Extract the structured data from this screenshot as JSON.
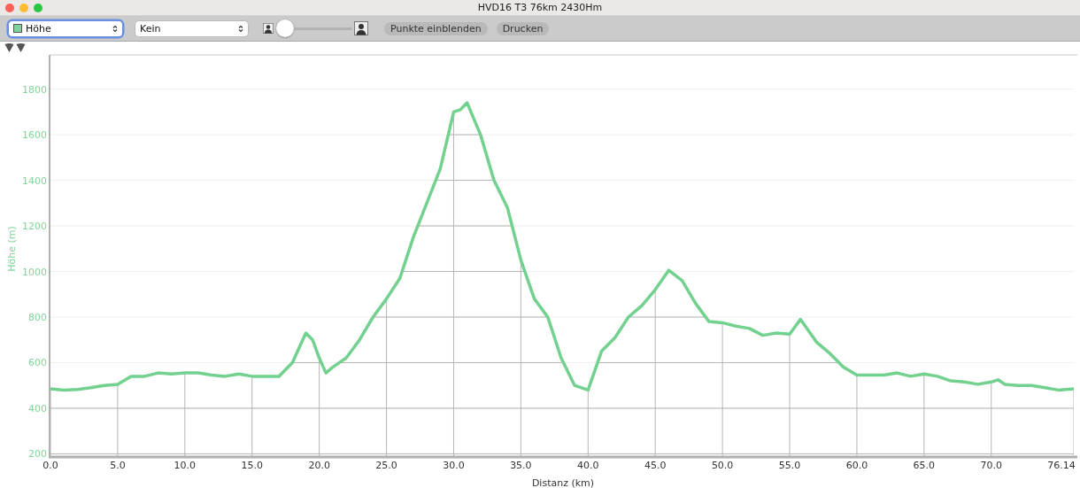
{
  "window": {
    "title": "HVD16 T3 76km 2430Hm"
  },
  "toolbar": {
    "data_select": {
      "value": "Höhe",
      "focused": true
    },
    "overlay_select": {
      "value": "Kein",
      "focused": false
    },
    "zoom_slider": {
      "level": 0
    },
    "buttons": [
      "Punkte einblenden",
      "Drucken"
    ]
  },
  "chart": {
    "chart_data": {
      "type": "line",
      "xlabel": "Distanz (km)",
      "ylabel": "Höhe (m)",
      "x": [
        0,
        1,
        2,
        3,
        4,
        5,
        6,
        7,
        8,
        9,
        10,
        11,
        12,
        13,
        14,
        15,
        16,
        17,
        18,
        19,
        19.5,
        20,
        20.5,
        21,
        22,
        23,
        24,
        25,
        26,
        27,
        28,
        29,
        30,
        30.5,
        31,
        32,
        33,
        34,
        35,
        36,
        37,
        38,
        39,
        40,
        41,
        42,
        43,
        44,
        45,
        46,
        47,
        48,
        49,
        50,
        51,
        52,
        53,
        54,
        55,
        55.8,
        57,
        58,
        59,
        60,
        61,
        62,
        63,
        64,
        65,
        66,
        67,
        68,
        69,
        70,
        70.5,
        71,
        72,
        73,
        74,
        75,
        76.14
      ],
      "grid": true,
      "series": [
        {
          "color": "#72d18e",
          "values": [
            485,
            480,
            482,
            490,
            500,
            505,
            540,
            540,
            555,
            550,
            555,
            555,
            545,
            540,
            550,
            540,
            540,
            540,
            600,
            730,
            700,
            620,
            555,
            580,
            620,
            700,
            800,
            880,
            970,
            1150,
            1300,
            1450,
            1700,
            1710,
            1740,
            1600,
            1400,
            1280,
            1050,
            880,
            800,
            620,
            500,
            480,
            650,
            710,
            800,
            850,
            920,
            1005,
            960,
            860,
            780,
            775,
            760,
            750,
            720,
            730,
            725,
            790,
            690,
            640,
            580,
            545,
            545,
            545,
            555,
            540,
            550,
            540,
            520,
            515,
            505,
            515,
            525,
            505,
            500,
            500,
            490,
            480,
            485
          ]
        }
      ],
      "xlim": [
        0,
        76.14
      ],
      "ylim": [
        190,
        1950
      ],
      "xticks": [
        {
          "value": 0,
          "label": "0.0"
        },
        {
          "value": 5,
          "label": "5.0"
        },
        {
          "value": 10,
          "label": "10.0"
        },
        {
          "value": 15,
          "label": "15.0"
        },
        {
          "value": 20,
          "label": "20.0"
        },
        {
          "value": 25,
          "label": "25.0"
        },
        {
          "value": 30,
          "label": "30.0"
        },
        {
          "value": 35,
          "label": "35.0"
        },
        {
          "value": 40,
          "label": "40.0"
        },
        {
          "value": 45,
          "label": "45.0"
        },
        {
          "value": 50,
          "label": "50.0"
        },
        {
          "value": 55,
          "label": "55.0"
        },
        {
          "value": 60,
          "label": "60.0"
        },
        {
          "value": 65,
          "label": "65.0"
        },
        {
          "value": 70,
          "label": "70.0"
        },
        {
          "value": 76.14,
          "label": "76.14"
        }
      ],
      "yticks": [
        200,
        400,
        600,
        800,
        1000,
        1200,
        1400,
        1600,
        1800
      ]
    }
  }
}
